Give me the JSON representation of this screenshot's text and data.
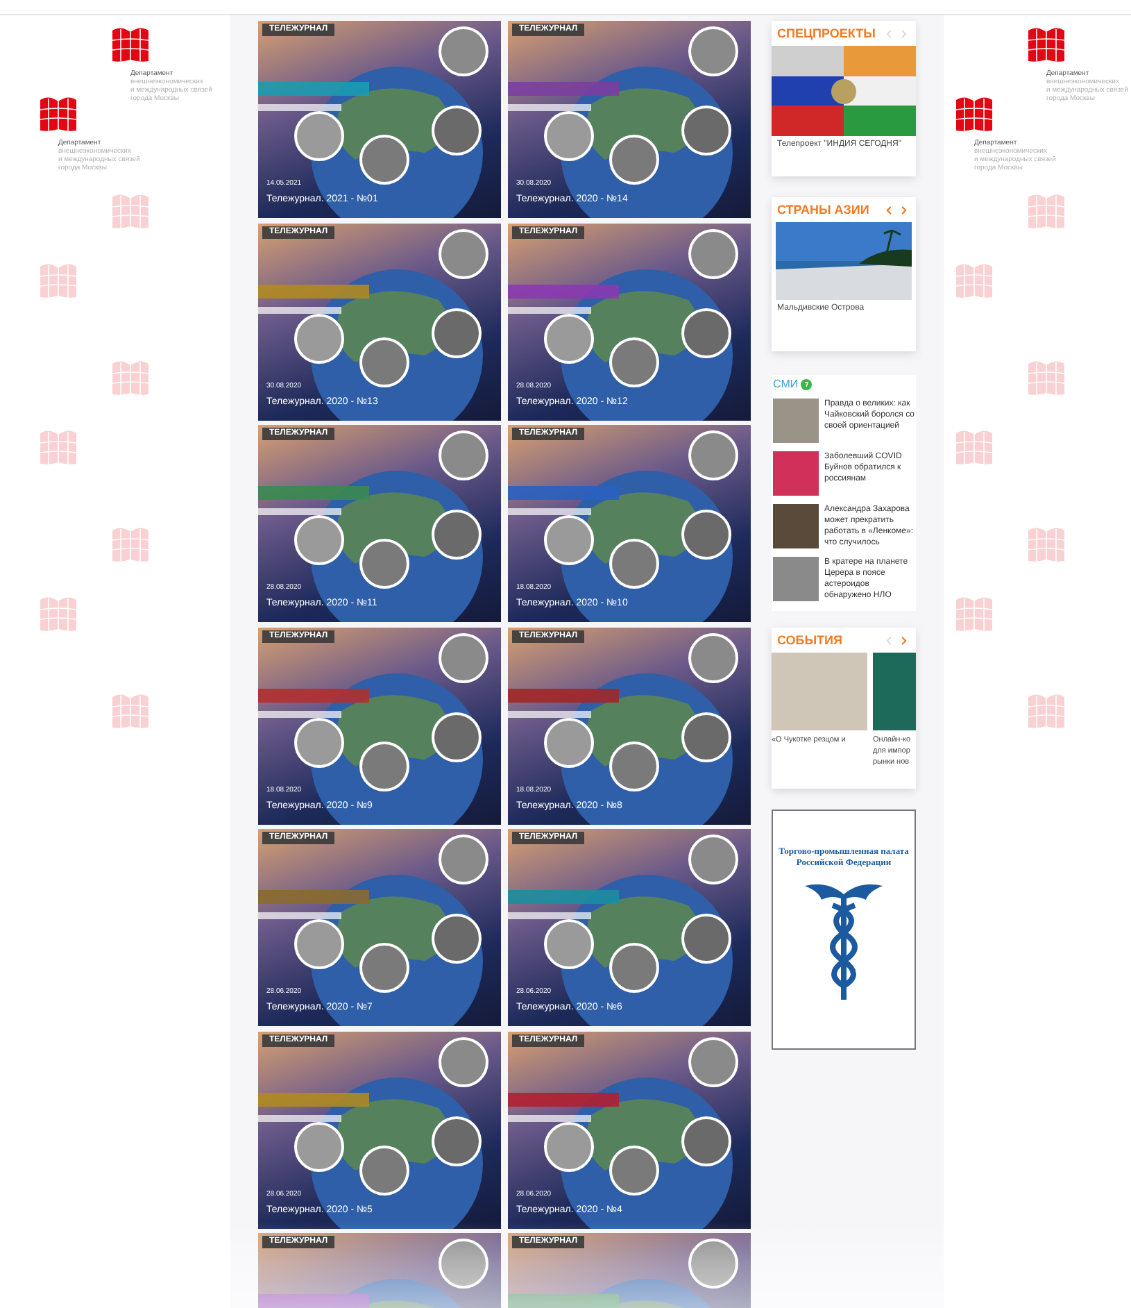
{
  "background_logos_left": [
    {
      "caption": [
        "Департамент",
        "внешнеэкономических",
        "и международных связей",
        "города Москвы"
      ]
    },
    {
      "caption": [
        "Департамент",
        "внешнеэкономических",
        "и международных связей",
        "города Москвы"
      ]
    }
  ],
  "background_logos_right": [
    {
      "caption": [
        "Департамент",
        "внешнеэкономических",
        "и международных связей",
        "города Москвы"
      ]
    },
    {
      "caption": [
        "Департамент",
        "внешнеэкономических",
        "и международных связей",
        "города Москвы"
      ]
    }
  ],
  "cards": [
    {
      "badge": "ТЕЛЕЖУРНАЛ",
      "date": "14.05.2021",
      "title": "Тележурнал. 2021 - №01"
    },
    {
      "badge": "ТЕЛЕЖУРНАЛ",
      "date": "30.08.2020",
      "title": "Тележурнал. 2020 - №14"
    },
    {
      "badge": "ТЕЛЕЖУРНАЛ",
      "date": "30.08.2020",
      "title": "Тележурнал. 2020 - №13"
    },
    {
      "badge": "ТЕЛЕЖУРНАЛ",
      "date": "28.08.2020",
      "title": "Тележурнал. 2020 - №12"
    },
    {
      "badge": "ТЕЛЕЖУРНАЛ",
      "date": "28.08.2020",
      "title": "Тележурнал. 2020 - №11"
    },
    {
      "badge": "ТЕЛЕЖУРНАЛ",
      "date": "18.08.2020",
      "title": "Тележурнал. 2020 - №10"
    },
    {
      "badge": "ТЕЛЕЖУРНАЛ",
      "date": "18.08.2020",
      "title": "Тележурнал. 2020 - №9"
    },
    {
      "badge": "ТЕЛЕЖУРНАЛ",
      "date": "18.08.2020",
      "title": "Тележурнал. 2020 - №8"
    },
    {
      "badge": "ТЕЛЕЖУРНАЛ",
      "date": "28.06.2020",
      "title": "Тележурнал. 2020 - №7"
    },
    {
      "badge": "ТЕЛЕЖУРНАЛ",
      "date": "28.06.2020",
      "title": "Тележурнал. 2020 - №6"
    },
    {
      "badge": "ТЕЛЕЖУРНАЛ",
      "date": "28.06.2020",
      "title": "Тележурнал. 2020 - №5"
    },
    {
      "badge": "ТЕЛЕЖУРНАЛ",
      "date": "28.06.2020",
      "title": "Тележурнал. 2020 - №4"
    },
    {
      "badge": "ТЕЛЕЖУРНАЛ"
    },
    {
      "badge": "ТЕЛЕЖУРНАЛ"
    }
  ],
  "sidebar": {
    "special_projects": {
      "title": "СПЕЦПРОЕКТЫ",
      "prev_disabled": true,
      "next_disabled": true,
      "caption": "Телепроект \"ИНДИЯ СЕГОДНЯ\""
    },
    "asia": {
      "title": "СТРАНЫ АЗИИ",
      "prev_disabled": false,
      "next_disabled": false,
      "caption": "Мальдивские Острова"
    },
    "media": {
      "title": "СМИ",
      "items": [
        {
          "text": "Правда о великих: как Чайковский боролся со своей ориентацией"
        },
        {
          "text": "Заболевший COVID Буйнов обратился к россиянам"
        },
        {
          "text": "Александра Захарова может прекратить работать в «Ленкоме»: что случилось"
        },
        {
          "text": "В кратере на планете Церера в поясе астероидов обнаружено НЛО"
        }
      ]
    },
    "events": {
      "title": "СОБЫТИЯ",
      "prev_disabled": true,
      "next_disabled": false,
      "slides": [
        {
          "caption": [
            "«О Чукотке резцом и"
          ]
        },
        {
          "caption": [
            "Онлайн-ко",
            "для импор",
            "рынки нов"
          ]
        }
      ]
    },
    "banner": {
      "text": "Торгово-промышленная палата Российской Федерации"
    }
  }
}
